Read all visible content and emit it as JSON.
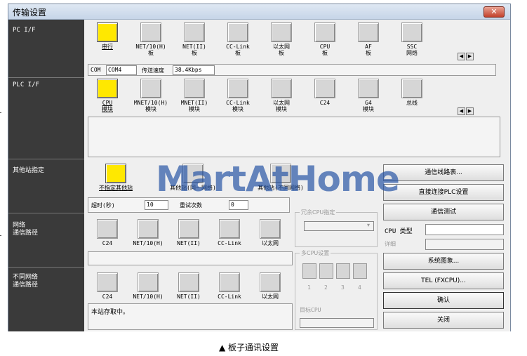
{
  "window": {
    "title": "传输设置",
    "close_glyph": "✕"
  },
  "sidebar": {
    "pc_if": "PC I/F",
    "plc_if": "PLC I/F",
    "other_station": "其他站指定",
    "network_route": "网络\n通信路径",
    "diff_network_route": "不同网络\n通信路径"
  },
  "pc_if_items": [
    {
      "label": "串行",
      "selected": true,
      "icon": "serial-port-icon"
    },
    {
      "label": "NET/10(H)\n板",
      "selected": false,
      "icon": "board-icon"
    },
    {
      "label": "NET(II)\n板",
      "selected": false,
      "icon": "board-icon"
    },
    {
      "label": "CC-Link\n板",
      "selected": false,
      "icon": "board-icon"
    },
    {
      "label": "以太网\n板",
      "selected": false,
      "icon": "board-icon"
    },
    {
      "label": "CPU\n板",
      "selected": false,
      "icon": "board-icon"
    },
    {
      "label": "AF\n板",
      "selected": false,
      "icon": "board-icon"
    },
    {
      "label": "SSC\n网络",
      "selected": false,
      "icon": "board-icon"
    }
  ],
  "com_row": {
    "com_label": "COM",
    "com_value": "COM4",
    "speed_label": "传送速度",
    "speed_value": "38.4Kbps"
  },
  "plc_if_items": [
    {
      "label": "CPU\n模块",
      "selected": true,
      "icon": "cpu-module-icon"
    },
    {
      "label": "MNET/10(H)\n模块",
      "selected": false,
      "icon": "module-icon"
    },
    {
      "label": "MNET(II)\n模块",
      "selected": false,
      "icon": "module-icon"
    },
    {
      "label": "CC-Link\n模块",
      "selected": false,
      "icon": "module-icon"
    },
    {
      "label": "以太网\n模块",
      "selected": false,
      "icon": "module-icon"
    },
    {
      "label": "C24",
      "selected": false,
      "icon": "module-icon"
    },
    {
      "label": "G4\n模块",
      "selected": false,
      "icon": "module-icon"
    },
    {
      "label": "总线",
      "selected": false,
      "icon": "module-icon"
    }
  ],
  "other_station": {
    "no_other": "不指定其他站",
    "same_net": "其他站(同一网络)",
    "diff_net": "其他站(不同网络)",
    "timeout_label": "超时(秒)",
    "timeout_value": "10",
    "retry_label": "重试次数",
    "retry_value": "0"
  },
  "route_items": [
    "C24",
    "NET/10(H)",
    "NET(II)",
    "CC-Link",
    "以太网"
  ],
  "diff_route_items": [
    "C24",
    "NET/10(H)",
    "NET(II)",
    "CC-Link",
    "以太网"
  ],
  "status_text": "本站存取中。",
  "redundant_cpu": {
    "title": "冗余CPU指定"
  },
  "multi_cpu": {
    "title": "多CPU设置",
    "numbers": [
      "1",
      "2",
      "3",
      "4"
    ],
    "target_label": "目标CPU"
  },
  "buttons": {
    "comm_route_table": "通信线路表...",
    "direct_conn": "直接连接PLC设置",
    "comm_test": "通信测试",
    "cpu_type_label": "CPU 类型",
    "detail_label": "详细",
    "system_image": "系统图象...",
    "tel": "TEL (FXCPU)...",
    "ok": "确认",
    "close": "关闭"
  },
  "watermark": "MartAtHome",
  "caption": "▲ 板子通讯设置"
}
